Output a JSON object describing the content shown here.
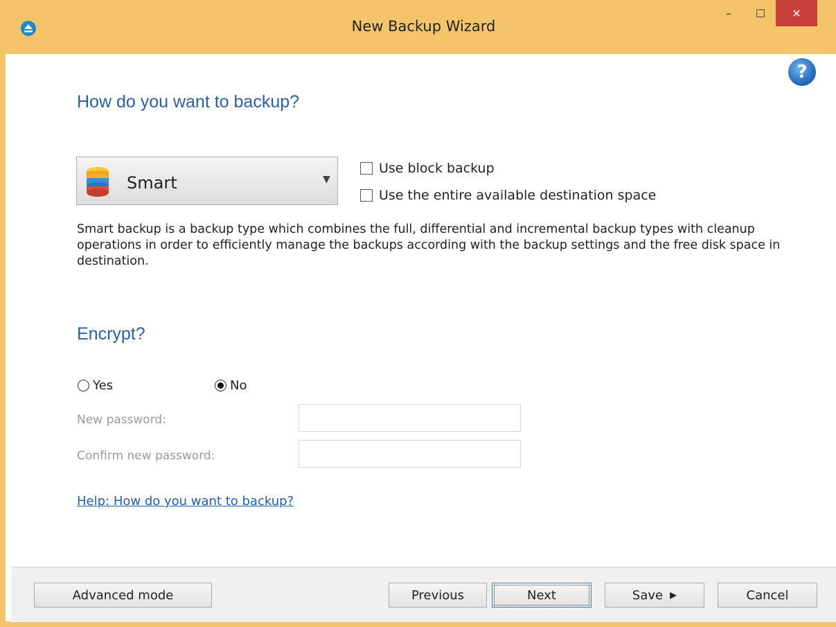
{
  "window": {
    "title": "New Backup Wizard",
    "minimize_glyph": "–",
    "maximize_glyph": "☐",
    "close_glyph": "✕"
  },
  "icons": {
    "app": "eject-icon",
    "help": "help-icon",
    "backup_type": "database-stack-icon"
  },
  "colors": {
    "titlebar": "#F3C46A",
    "close": "#C9403A",
    "heading": "#2A5FA8",
    "link": "#1E5FB4"
  },
  "main": {
    "help_glyph": "?",
    "backup_heading": "How do you want to backup?",
    "backup_type": {
      "selected": "Smart"
    },
    "options": {
      "block_backup_label": "Use block backup",
      "entire_space_label": "Use the entire available destination space"
    },
    "description": "Smart backup is a backup type which combines the full, differential and incremental backup types with cleanup operations in order to efficiently manage the backups according with the backup settings and the free disk space in destination.",
    "encrypt_heading": "Encrypt?",
    "encrypt": {
      "yes_label": "Yes",
      "no_label": "No",
      "selected": "No"
    },
    "new_password_label": "New password:",
    "confirm_password_label": "Confirm new password:",
    "new_password_value": "",
    "confirm_password_value": "",
    "help_link": "Help: How do you want to backup?"
  },
  "footer": {
    "advanced_mode": "Advanced mode",
    "previous": "Previous",
    "next": "Next",
    "save": "Save",
    "save_arrow": "▶",
    "cancel": "Cancel"
  }
}
